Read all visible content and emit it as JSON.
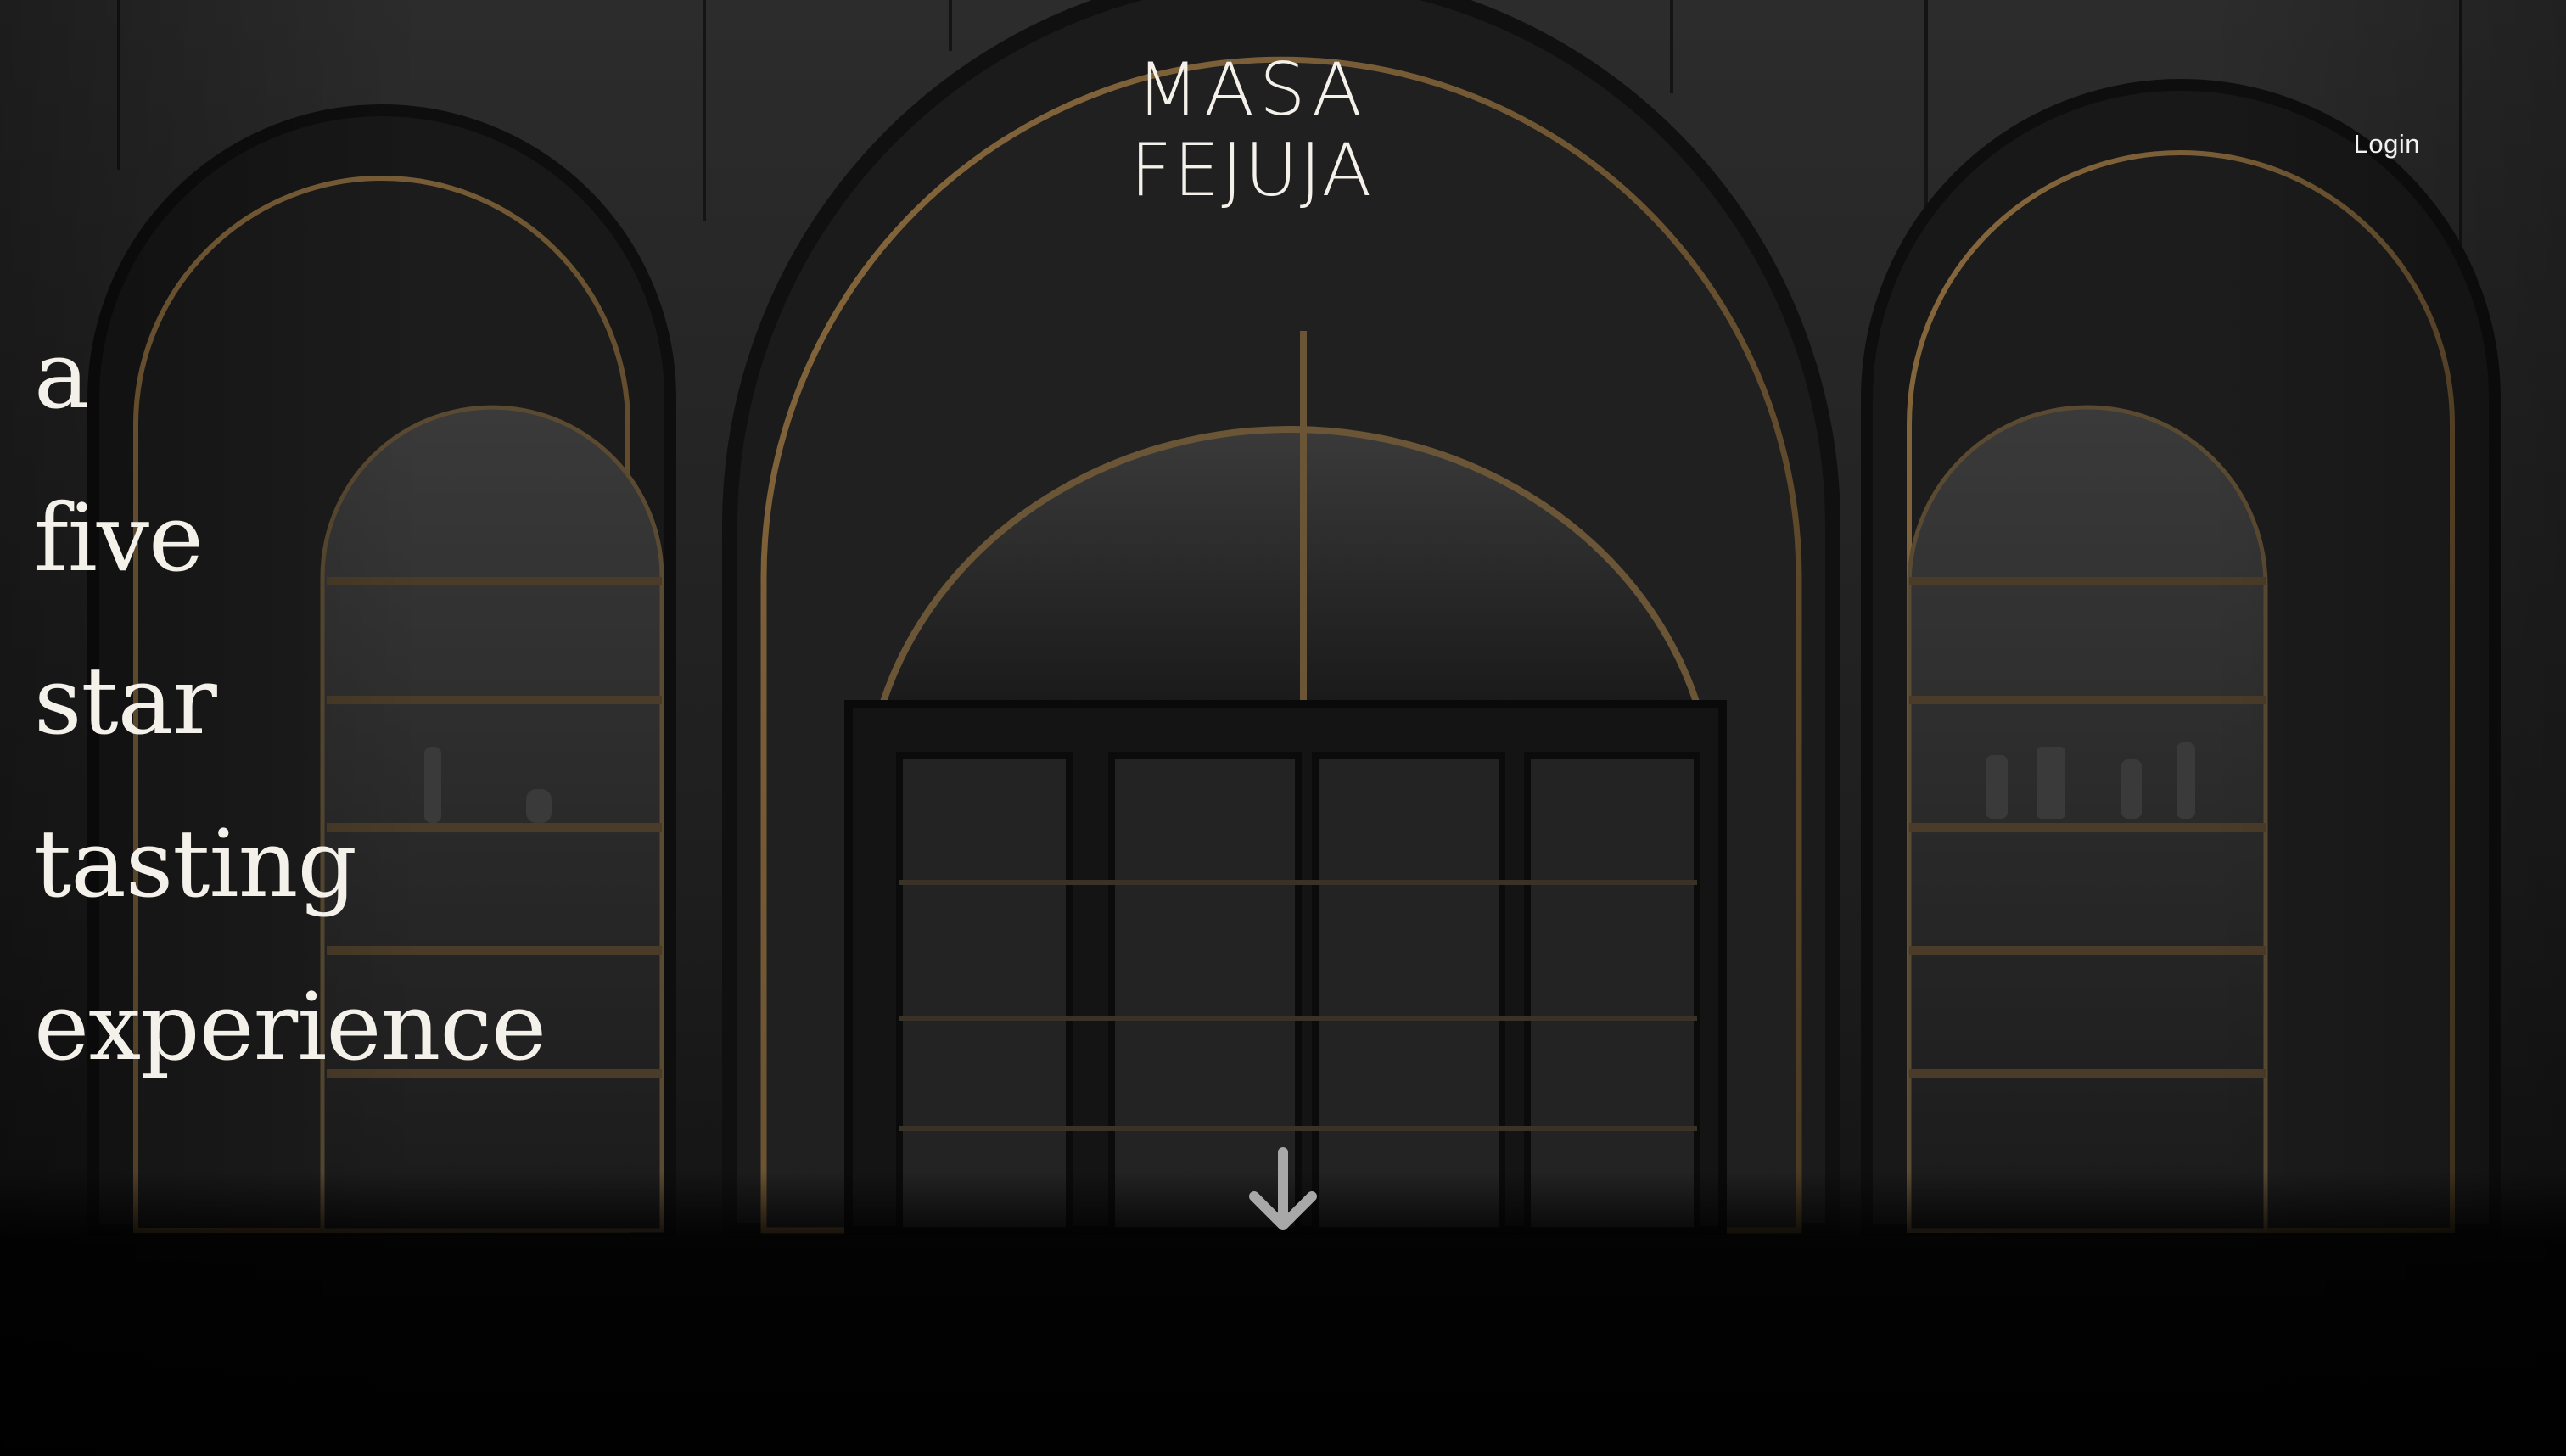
{
  "header": {
    "logo": {
      "line1": "MASA",
      "line2": "FEJUJA"
    },
    "login_label": "Login"
  },
  "hero": {
    "tagline": [
      "a",
      "five",
      "star",
      "tasting",
      "experience"
    ],
    "scroll_icon": "arrow-down-icon"
  },
  "colors": {
    "text": "#f4f1ea",
    "accent_brass": "#8a6a3e",
    "background": "#0b0b0b"
  }
}
